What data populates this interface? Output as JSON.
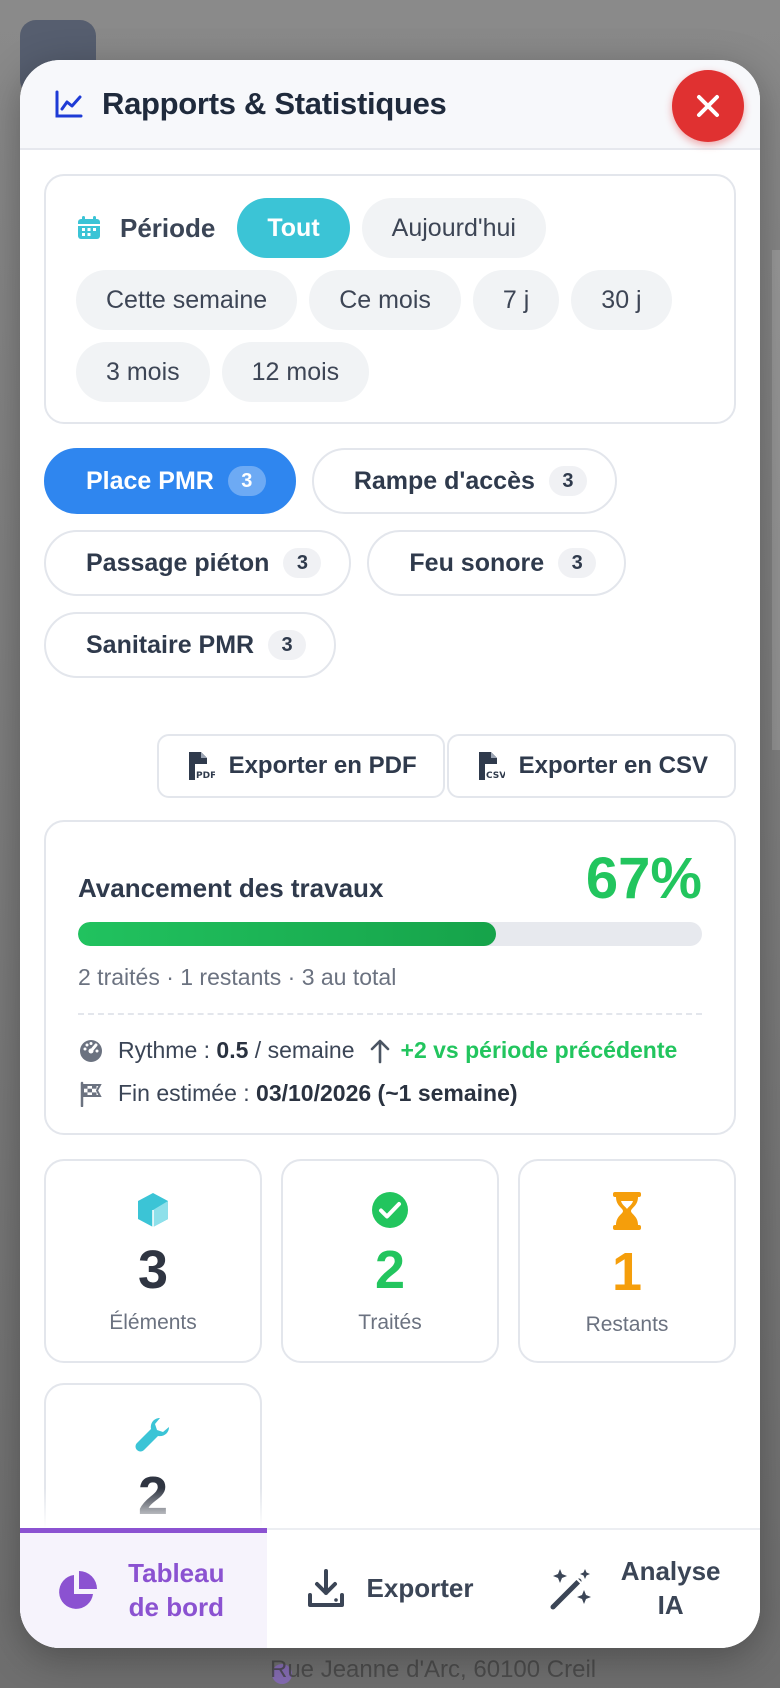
{
  "header": {
    "title": "Rapports & Statistiques"
  },
  "period": {
    "label": "Période",
    "chips": [
      {
        "label": "Tout",
        "active": true
      },
      {
        "label": "Aujourd'hui",
        "active": false
      },
      {
        "label": "Cette semaine",
        "active": false
      },
      {
        "label": "Ce mois",
        "active": false
      },
      {
        "label": "7 j",
        "active": false
      },
      {
        "label": "30 j",
        "active": false
      },
      {
        "label": "3 mois",
        "active": false
      },
      {
        "label": "12 mois",
        "active": false
      }
    ]
  },
  "categories": [
    {
      "label": "Place PMR",
      "count": "3",
      "active": true
    },
    {
      "label": "Rampe d'accès",
      "count": "3",
      "active": false
    },
    {
      "label": "Passage piéton",
      "count": "3",
      "active": false
    },
    {
      "label": "Feu sonore",
      "count": "3",
      "active": false
    },
    {
      "label": "Sanitaire PMR",
      "count": "3",
      "active": false
    }
  ],
  "export": {
    "pdf_label": "Exporter en PDF",
    "csv_label": "Exporter en CSV"
  },
  "progress": {
    "title": "Avancement des travaux",
    "percent": "67%",
    "percent_value": 67,
    "summary": "2 traités · 1 restants · 3 au total",
    "rhythm_prefix": "Rythme :",
    "rhythm_value": "0.5",
    "rhythm_suffix": "/ semaine",
    "trend": "+2 vs période précédente",
    "end_prefix": "Fin estimée :",
    "end_value": "03/10/2026 (~1 semaine)"
  },
  "stats": [
    {
      "value": "3",
      "label": "Éléments",
      "color": "#2f3542"
    },
    {
      "value": "2",
      "label": "Traités",
      "color": "#22c55e"
    },
    {
      "value": "1",
      "label": "Restants",
      "color": "#f59e0b"
    },
    {
      "value": "2",
      "label": "",
      "color": "#2f3542"
    }
  ],
  "bottom_nav": [
    {
      "label": "Tableau de bord",
      "active": true
    },
    {
      "label": "Exporter",
      "active": false
    },
    {
      "label": "Analyse IA",
      "active": false
    }
  ],
  "background": {
    "address": "Rue Jeanne d'Arc, 60100 Creil"
  },
  "colors": {
    "accent_cyan": "#3bc4d6",
    "accent_blue": "#2f86ef",
    "success": "#22c55e",
    "warning": "#f59e0b",
    "danger": "#e03131",
    "purple": "#8b52d1"
  },
  "icons": {
    "header": "chart-line-icon",
    "close": "close-icon",
    "period": "calendar-icon"
  }
}
